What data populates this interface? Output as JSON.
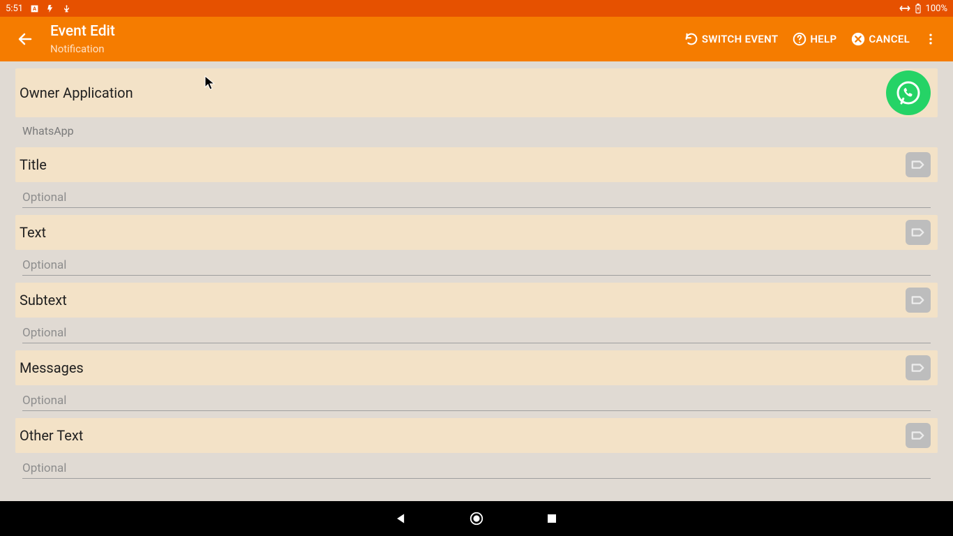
{
  "status": {
    "time": "5:51",
    "battery": "100%"
  },
  "header": {
    "title": "Event Edit",
    "subtitle": "Notification",
    "actions": {
      "switch": "SWITCH EVENT",
      "help": "HELP",
      "cancel": "CANCEL"
    }
  },
  "owner": {
    "label": "Owner Application",
    "value": "WhatsApp"
  },
  "fields": {
    "title": {
      "label": "Title",
      "placeholder": "Optional",
      "value": ""
    },
    "text": {
      "label": "Text",
      "placeholder": "Optional",
      "value": ""
    },
    "subtext": {
      "label": "Subtext",
      "placeholder": "Optional",
      "value": ""
    },
    "messages": {
      "label": "Messages",
      "placeholder": "Optional",
      "value": ""
    },
    "othertext": {
      "label": "Other Text",
      "placeholder": "Optional",
      "value": ""
    }
  }
}
